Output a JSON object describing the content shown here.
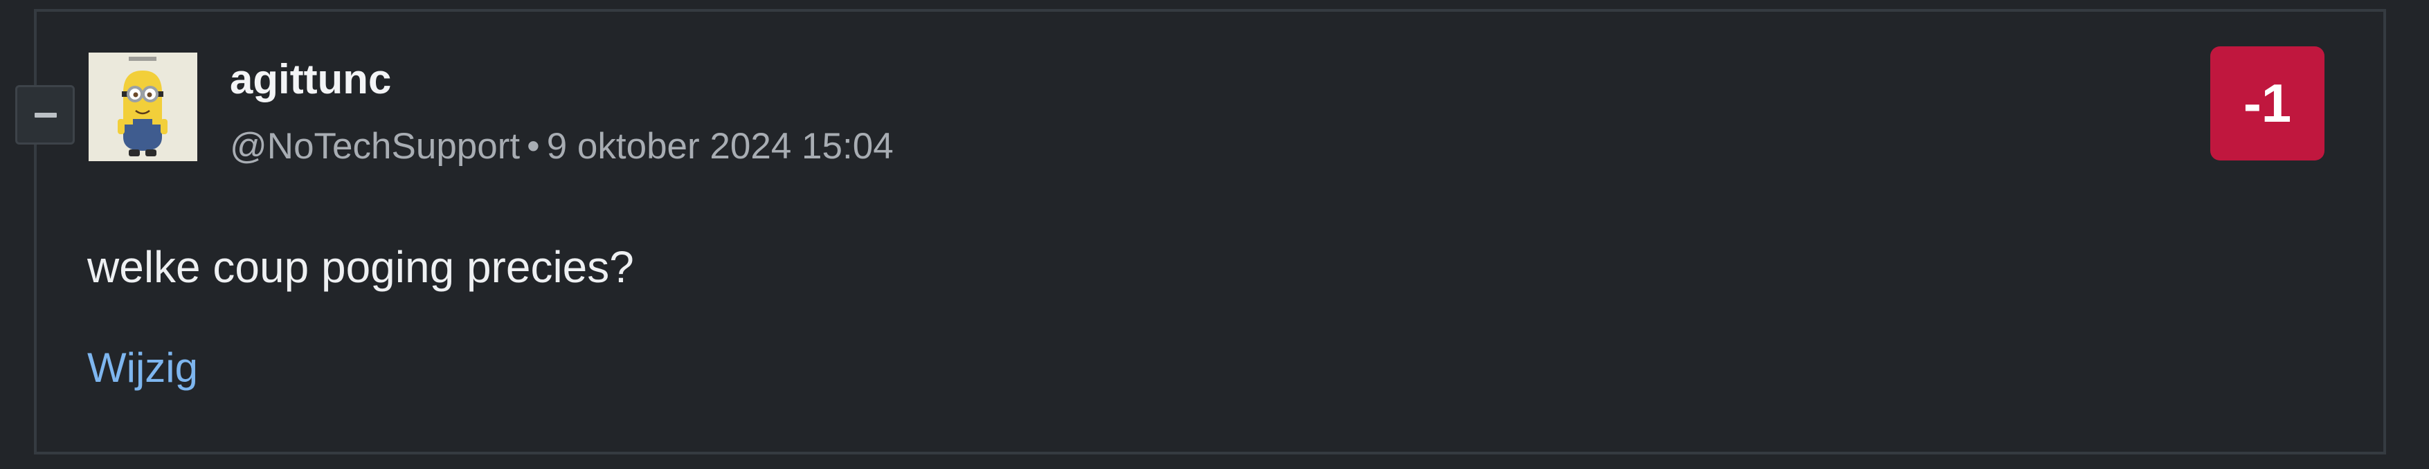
{
  "comment": {
    "author": {
      "display_name": "agittunc",
      "handle": "@NoTechSupport"
    },
    "separator": "•",
    "timestamp": "9 oktober 2024 15:04",
    "score": "-1",
    "body": "welke coup poging precies?",
    "edit_label": "Wijzig",
    "avatar_icon": "minion-avatar-icon",
    "collapse_icon": "minus-icon"
  },
  "colors": {
    "background": "#222529",
    "score_negative": "#c0173e",
    "link": "#7eb6ef",
    "meta_text": "#a8adb3"
  }
}
